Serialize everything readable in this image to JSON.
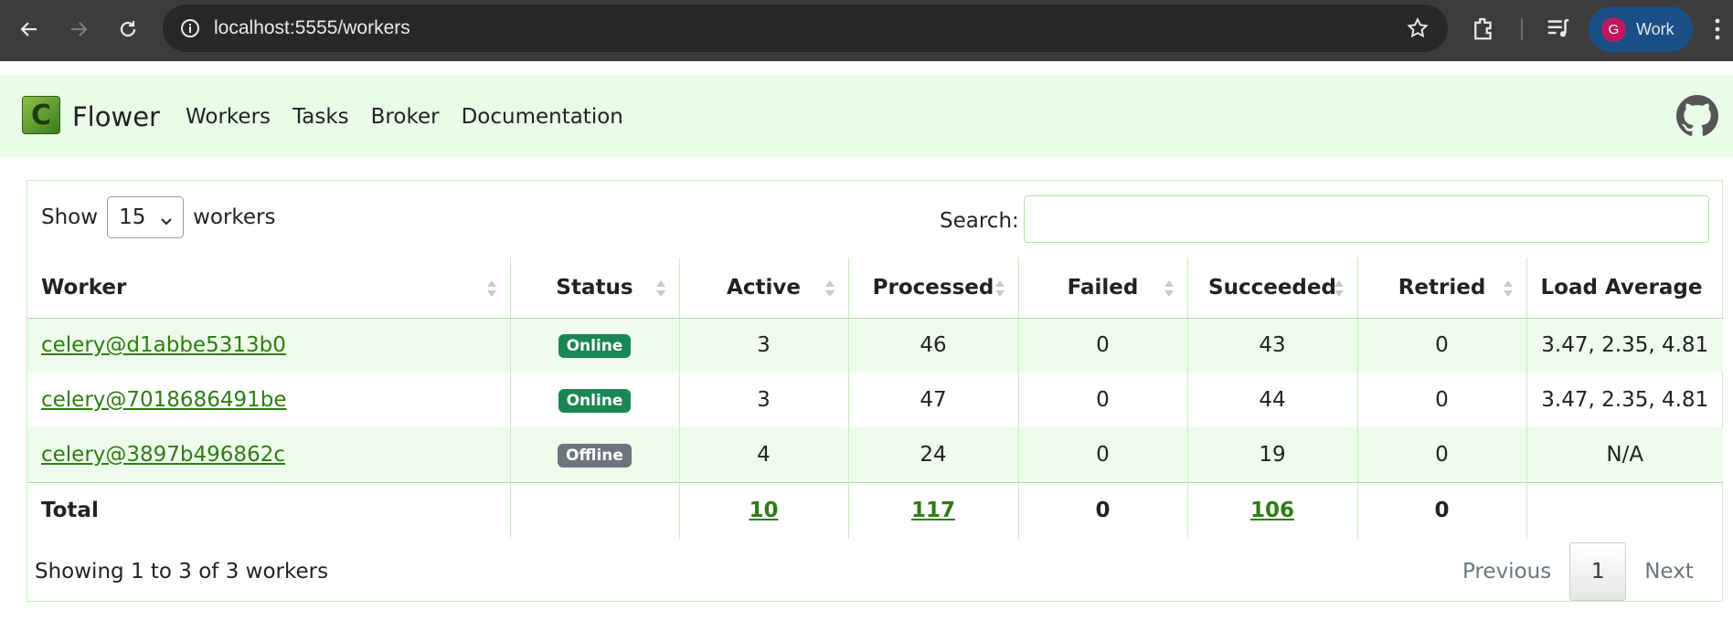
{
  "browser": {
    "url": "localhost:5555/workers",
    "profile_initial": "G",
    "profile_label": "Work"
  },
  "navbar": {
    "brand": "Flower",
    "links": [
      "Workers",
      "Tasks",
      "Broker",
      "Documentation"
    ]
  },
  "controls": {
    "show_label": "Show",
    "page_size": "15",
    "show_suffix": "workers",
    "search_label": "Search:",
    "search_value": ""
  },
  "table": {
    "headers": [
      "Worker",
      "Status",
      "Active",
      "Processed",
      "Failed",
      "Succeeded",
      "Retried",
      "Load Average"
    ],
    "rows": [
      {
        "worker": "celery@d1abbe5313b0",
        "status": "Online",
        "active": "3",
        "processed": "46",
        "failed": "0",
        "succeeded": "43",
        "retried": "0",
        "load": "3.47, 2.35, 4.81"
      },
      {
        "worker": "celery@7018686491be",
        "status": "Online",
        "active": "3",
        "processed": "47",
        "failed": "0",
        "succeeded": "44",
        "retried": "0",
        "load": "3.47, 2.35, 4.81"
      },
      {
        "worker": "celery@3897b496862c",
        "status": "Offline",
        "active": "4",
        "processed": "24",
        "failed": "0",
        "succeeded": "19",
        "retried": "0",
        "load": "N/A"
      }
    ],
    "total": {
      "label": "Total",
      "active": "10",
      "processed": "117",
      "failed": "0",
      "succeeded": "106",
      "retried": "0"
    }
  },
  "footer": {
    "info": "Showing 1 to 3 of 3 workers",
    "previous": "Previous",
    "page": "1",
    "next": "Next"
  },
  "colors": {
    "online": "#198754",
    "offline": "#6c757d",
    "link": "#2e7d12",
    "navbar_bg": "#e9fce7"
  },
  "icons": [
    "back-arrow-icon",
    "forward-arrow-icon",
    "reload-icon",
    "info-icon",
    "star-icon",
    "extensions-icon",
    "media-icon",
    "kebab-menu-icon",
    "celery-logo-icon",
    "github-icon",
    "chevron-down-icon",
    "sort-icon"
  ]
}
